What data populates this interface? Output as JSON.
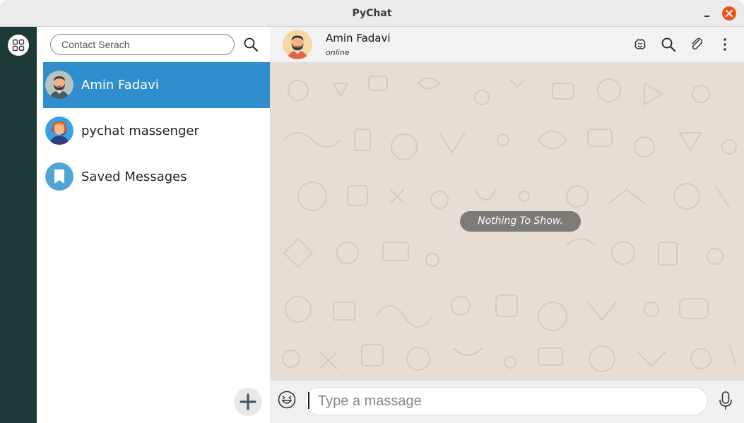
{
  "window": {
    "title": "PyChat",
    "minimize_icon": "minimize-icon",
    "close_icon": "close-icon",
    "close_color": "#e95420"
  },
  "rail": {
    "menu_icon": "grid-menu-icon",
    "color": "#1e3a38"
  },
  "contacts": {
    "search": {
      "placeholder": "Contact Serach",
      "value": "",
      "icon": "search-icon"
    },
    "items": [
      {
        "name": "Amin Fadavi",
        "active": true,
        "avatar": "bearded-man-avatar"
      },
      {
        "name": "pychat massenger",
        "active": false,
        "avatar": "headset-support-avatar"
      },
      {
        "name": "Saved Messages",
        "active": false,
        "avatar": "bookmark-avatar"
      }
    ],
    "active_color": "#2f8fcc",
    "add_icon": "plus-icon"
  },
  "chat": {
    "header": {
      "name": "Amin Fadavi",
      "status": "online",
      "icons": [
        "brain-icon",
        "search-icon",
        "paperclip-icon",
        "more-vertical-icon"
      ]
    },
    "empty_text": "Nothing To Show.",
    "background_color": "#e6ddd4",
    "composer": {
      "placeholder": "Type a massage",
      "value": "",
      "emoji_icon": "emoji-icon",
      "mic_icon": "microphone-icon"
    }
  }
}
